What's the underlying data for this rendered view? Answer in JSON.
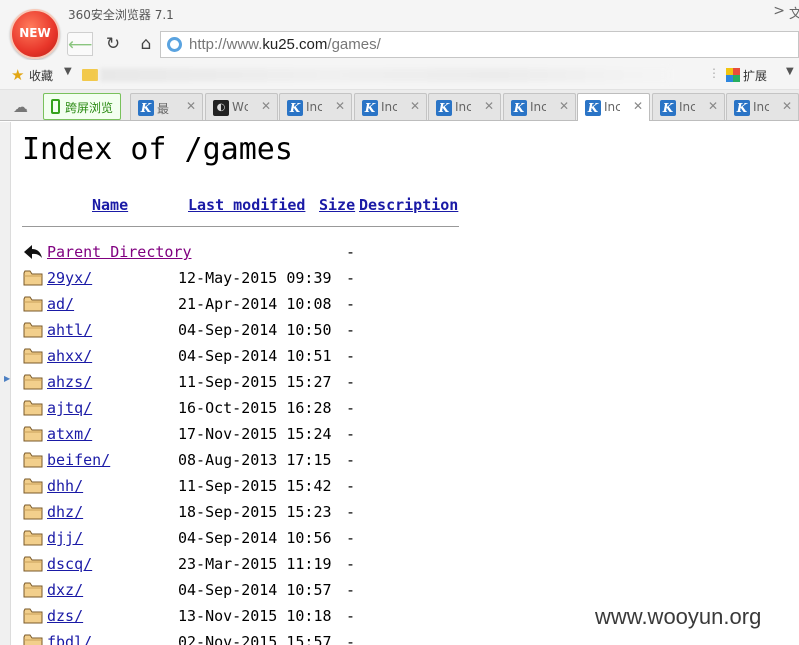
{
  "browser": {
    "badge": "NEW",
    "app_title": "360安全浏览器 7.1",
    "title_right": ">",
    "title_right2": "文",
    "url": "http://www.ku25.com/games/",
    "bookmarks": {
      "favorites_label": "收藏",
      "ext_label": "扩展"
    },
    "phone_tab_label": "跨屏浏览",
    "tabs": [
      {
        "title": "最",
        "icon": "k-logo-icon"
      },
      {
        "title": "Wc",
        "icon": "dark-site-icon"
      },
      {
        "title": "Inc",
        "icon": "k-logo-icon"
      },
      {
        "title": "Inc",
        "icon": "k-logo-icon"
      },
      {
        "title": "Inc",
        "icon": "k-logo-icon"
      },
      {
        "title": "Inc",
        "icon": "k-logo-icon"
      },
      {
        "title": "Inc",
        "icon": "k-logo-icon",
        "active": true
      },
      {
        "title": "Inc",
        "icon": "k-logo-icon"
      },
      {
        "title": "Inc",
        "icon": "k-logo-icon"
      }
    ]
  },
  "listing": {
    "title": "Index of /games",
    "headers": {
      "name": "Name",
      "last_modified": "Last modified",
      "size": "Size",
      "description": "Description"
    },
    "parent": {
      "name": "Parent Directory",
      "modified": "",
      "size": "-"
    },
    "rows": [
      {
        "name": "29yx/",
        "modified": "12-May-2015 09:39",
        "size": "-"
      },
      {
        "name": "ad/",
        "modified": "21-Apr-2014 10:08",
        "size": "-"
      },
      {
        "name": "ahtl/",
        "modified": "04-Sep-2014 10:50",
        "size": "-"
      },
      {
        "name": "ahxx/",
        "modified": "04-Sep-2014 10:51",
        "size": "-"
      },
      {
        "name": "ahzs/",
        "modified": "11-Sep-2015 15:27",
        "size": "-"
      },
      {
        "name": "ajtq/",
        "modified": "16-Oct-2015 16:28",
        "size": "-"
      },
      {
        "name": "atxm/",
        "modified": "17-Nov-2015 15:24",
        "size": "-"
      },
      {
        "name": "beifen/",
        "modified": "08-Aug-2013 17:15",
        "size": "-"
      },
      {
        "name": "dhh/",
        "modified": "11-Sep-2015 15:42",
        "size": "-"
      },
      {
        "name": "dhz/",
        "modified": "18-Sep-2015 15:23",
        "size": "-"
      },
      {
        "name": "djj/",
        "modified": "04-Sep-2014 10:56",
        "size": "-"
      },
      {
        "name": "dscq/",
        "modified": "23-Mar-2015 11:19",
        "size": "-"
      },
      {
        "name": "dxz/",
        "modified": "04-Sep-2014 10:57",
        "size": "-"
      },
      {
        "name": "dzs/",
        "modified": "13-Nov-2015 10:18",
        "size": "-"
      },
      {
        "name": "fbdl/",
        "modified": "02-Nov-2015 15:57",
        "size": "-"
      }
    ]
  },
  "watermark": "www.wooyun.org",
  "colors": {
    "link": "#1a1aa6",
    "visited": "#800080",
    "tab_accent": "#2a74c6",
    "phone_tab": "#35a21b"
  }
}
